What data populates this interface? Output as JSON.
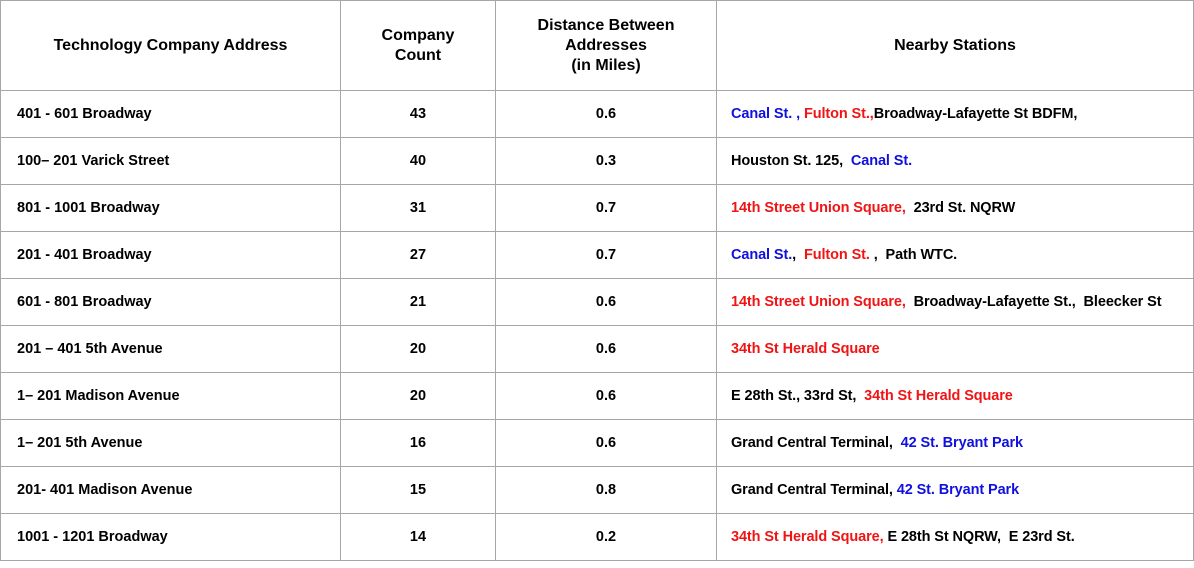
{
  "table": {
    "headers": [
      [
        "Technology Company Address"
      ],
      [
        "Company",
        "Count"
      ],
      [
        "Distance Between",
        "Addresses",
        "(in Miles)"
      ],
      [
        "Nearby Stations"
      ]
    ],
    "colors": {
      "blue": "#1010e0",
      "red": "#f01414",
      "black": "#000000",
      "border": "#a6a6a6"
    },
    "rows": [
      {
        "address": "401 - 601 Broadway",
        "count": "43",
        "distance": "0.6",
        "stations": [
          {
            "text": "Canal St. , ",
            "color": "blue"
          },
          {
            "text": "Fulton St.,",
            "color": "red"
          },
          {
            "text": "Broadway-Lafayette St BDFM,",
            "color": "black"
          }
        ]
      },
      {
        "address": "100– 201 Varick Street",
        "count": "40",
        "distance": "0.3",
        "stations": [
          {
            "text": "Houston St. 125,  ",
            "color": "black"
          },
          {
            "text": "Canal St.",
            "color": "blue"
          }
        ]
      },
      {
        "address": "801 - 1001 Broadway",
        "count": "31",
        "distance": "0.7",
        "stations": [
          {
            "text": "14th Street Union Square,  ",
            "color": "red"
          },
          {
            "text": "23rd St. NQRW",
            "color": "black"
          }
        ]
      },
      {
        "address": "201 - 401 Broadway",
        "count": "27",
        "distance": "0.7",
        "stations": [
          {
            "text": "Canal St.",
            "color": "blue"
          },
          {
            "text": ",  ",
            "color": "black"
          },
          {
            "text": "Fulton St. ",
            "color": "red"
          },
          {
            "text": ",  Path WTC.",
            "color": "black"
          }
        ]
      },
      {
        "address": "601 - 801 Broadway",
        "count": "21",
        "distance": "0.6",
        "stations": [
          {
            "text": "14th Street Union Square,  ",
            "color": "red"
          },
          {
            "text": "Broadway-Lafayette St.,  Bleecker St",
            "color": "black"
          }
        ]
      },
      {
        "address": "201 – 401 5th Avenue",
        "count": "20",
        "distance": "0.6",
        "stations": [
          {
            "text": "34th St Herald Square",
            "color": "red"
          }
        ]
      },
      {
        "address": "1– 201 Madison Avenue",
        "count": "20",
        "distance": "0.6",
        "stations": [
          {
            "text": "E 28th St., 33rd St,  ",
            "color": "black"
          },
          {
            "text": "34th St Herald Square",
            "color": "red"
          }
        ]
      },
      {
        "address": "1– 201  5th Avenue",
        "count": "16",
        "distance": "0.6",
        "stations": [
          {
            "text": "Grand Central Terminal,  ",
            "color": "black"
          },
          {
            "text": "42 St. Bryant Park",
            "color": "blue"
          }
        ]
      },
      {
        "address": "201- 401 Madison Avenue",
        "count": "15",
        "distance": "0.8",
        "stations": [
          {
            "text": "Grand Central Terminal, ",
            "color": "black"
          },
          {
            "text": "42 St. Bryant Park",
            "color": "blue"
          }
        ]
      },
      {
        "address": "1001 - 1201 Broadway",
        "count": "14",
        "distance": "0.2",
        "stations": [
          {
            "text": "34th St Herald Square, ",
            "color": "red"
          },
          {
            "text": "E 28th St NQRW,  E 23rd St.",
            "color": "black"
          }
        ]
      }
    ]
  }
}
